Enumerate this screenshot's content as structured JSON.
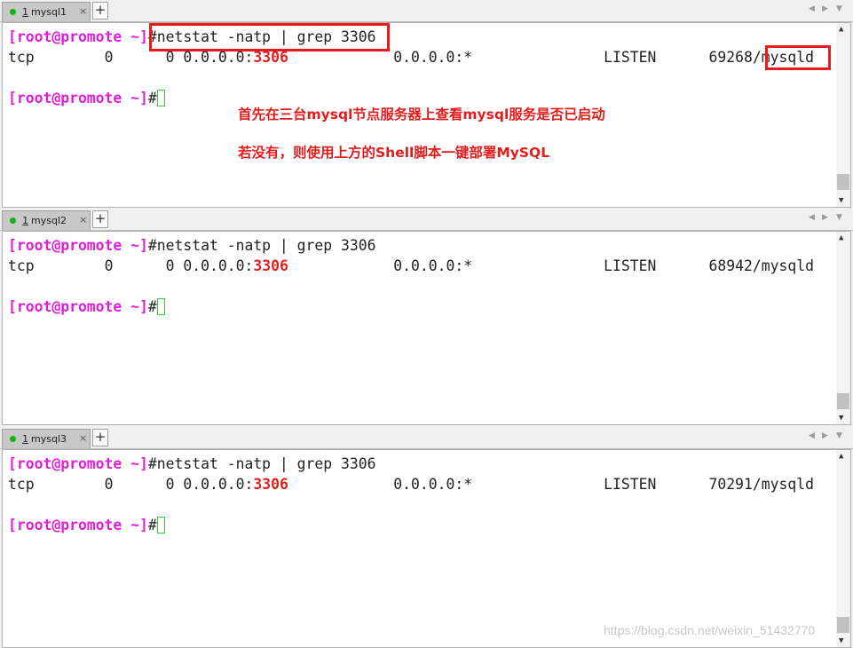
{
  "panels": [
    {
      "tab": {
        "number": "1",
        "title": "mysql1",
        "close": "×"
      },
      "prompt": "[root@promote ~]",
      "hash": "#",
      "command": "netstat -natp | grep 3306",
      "output": {
        "proto": "tcp",
        "recvq": "0",
        "sendq": "0",
        "local_ip": "0.0.0.0:",
        "local_port": "3306",
        "foreign": "0.0.0.0:*",
        "state": "LISTEN",
        "pid": "69268/",
        "program": "mysqld"
      }
    },
    {
      "tab": {
        "number": "1",
        "title": "mysql2",
        "close": "×"
      },
      "prompt": "[root@promote ~]",
      "hash": "#",
      "command": "netstat -natp | grep 3306",
      "output": {
        "proto": "tcp",
        "recvq": "0",
        "sendq": "0",
        "local_ip": "0.0.0.0:",
        "local_port": "3306",
        "foreign": "0.0.0.0:*",
        "state": "LISTEN",
        "pid": "68942/",
        "program": "mysqld"
      }
    },
    {
      "tab": {
        "number": "1",
        "title": "mysql3",
        "close": "×"
      },
      "prompt": "[root@promote ~]",
      "hash": "#",
      "command": "netstat -natp | grep 3306",
      "output": {
        "proto": "tcp",
        "recvq": "0",
        "sendq": "0",
        "local_ip": "0.0.0.0:",
        "local_port": "3306",
        "foreign": "0.0.0.0:*",
        "state": "LISTEN",
        "pid": "70291/",
        "program": "mysqld"
      }
    }
  ],
  "new_tab_label": "+",
  "annotations": {
    "line1": "首先在三台mysql节点服务器上查看mysql服务是否已启动",
    "line2": "若没有，则使用上方的Shell脚本一键部署MySQL"
  },
  "watermark": "https://blog.csdn.net/weixin_51432770",
  "colors": {
    "prompt": "#e020d8",
    "port": "#e02020",
    "highlight": "#e81a1a",
    "annotation": "#e21d1d",
    "cursor": "#33cc33"
  }
}
